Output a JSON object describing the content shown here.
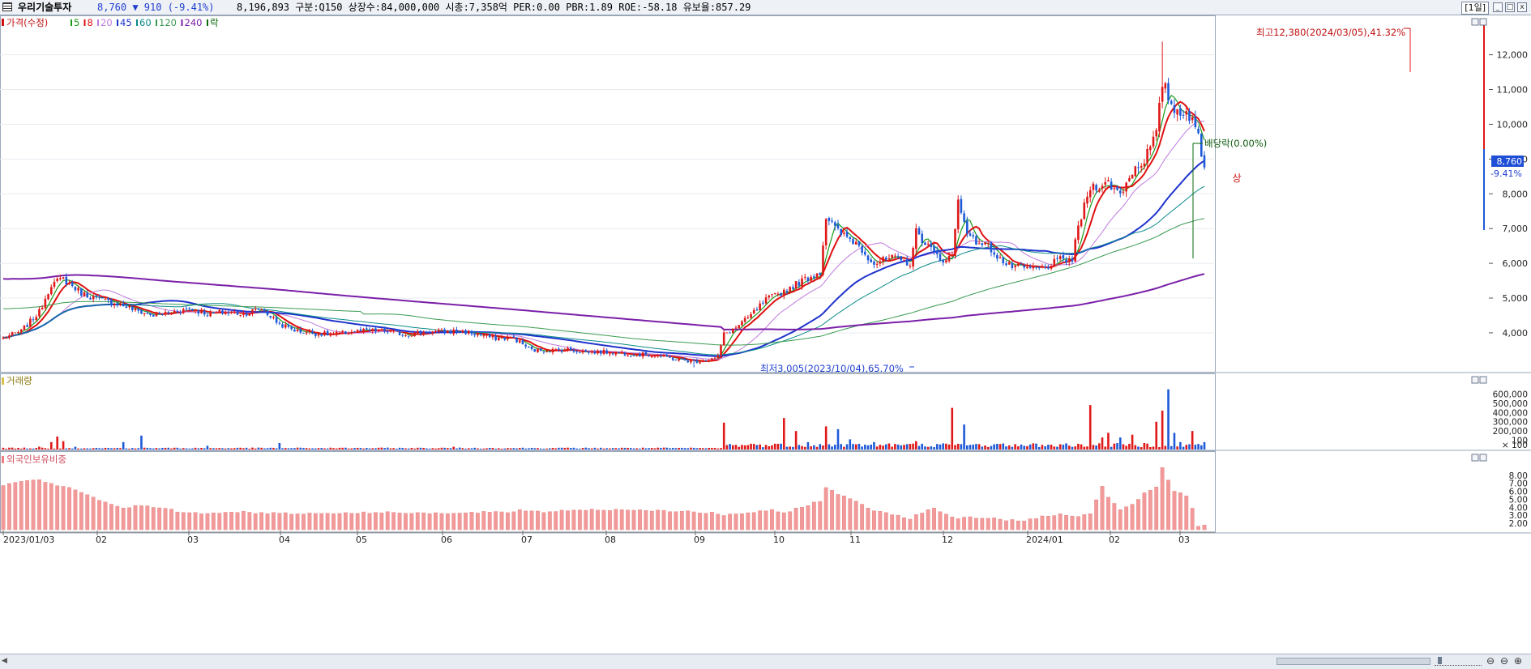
{
  "header": {
    "stock_name": "우리기술투자",
    "price_text": "8,760 ▼ 910 (-9.41%)",
    "info_text": "8,196,893 구분:Q150 상장수:84,000,000 시총:7,358억 PER:0.00 PBR:1.89 ROE:-58.18 유보율:857.29",
    "period_label": "[1일]",
    "win_minimize": "_",
    "win_restore": "□",
    "win_close": "x"
  },
  "legend_price": {
    "title": "가격(수정)",
    "items": [
      {
        "label": "5",
        "color": "#1a9a1a"
      },
      {
        "label": "8",
        "color": "#e01010"
      },
      {
        "label": "20",
        "color": "#c07adc"
      },
      {
        "label": "45",
        "color": "#1f33cc"
      },
      {
        "label": "60",
        "color": "#0a8a8a"
      },
      {
        "label": "120",
        "color": "#3a9a50"
      },
      {
        "label": "240",
        "color": "#7a1fa8"
      },
      {
        "label": "락",
        "color": "#0a6a0a"
      }
    ]
  },
  "annotations": {
    "high": "최고12,380(2024/03/05),41.32%",
    "low": "최저3,005(2023/10/04),65.70%",
    "dividend": "배당락(0.00%)",
    "limit_up": "상"
  },
  "current_price_label": "8,760",
  "current_change_label": "-9.41%",
  "chart_data": [
    {
      "type": "candlestick",
      "title": "가격(수정)",
      "y_ticks": [
        4000,
        5000,
        6000,
        7000,
        8000,
        9000,
        10000,
        11000,
        12000
      ],
      "y_tick_labels": [
        "4,000",
        "5,000",
        "6,000",
        "7,000",
        "8,000",
        "9,000",
        "10,000",
        "11,000",
        "12,000"
      ],
      "ylim": [
        2950,
        12900
      ],
      "x_labels": [
        "2023/01/03",
        "02",
        "03",
        "04",
        "05",
        "06",
        "07",
        "08",
        "09",
        "10",
        "11",
        "12",
        "2024/01",
        "02",
        "03"
      ],
      "anchor_closes": [
        [
          0,
          3850
        ],
        [
          6,
          4050
        ],
        [
          12,
          4600
        ],
        [
          16,
          5400
        ],
        [
          20,
          5550
        ],
        [
          26,
          5150
        ],
        [
          32,
          4950
        ],
        [
          38,
          4850
        ],
        [
          44,
          4650
        ],
        [
          50,
          4500
        ],
        [
          56,
          4600
        ],
        [
          62,
          4700
        ],
        [
          68,
          4550
        ],
        [
          74,
          4600
        ],
        [
          80,
          4550
        ],
        [
          86,
          4700
        ],
        [
          92,
          4250
        ],
        [
          98,
          4050
        ],
        [
          104,
          3980
        ],
        [
          110,
          3950
        ],
        [
          116,
          4030
        ],
        [
          122,
          4060
        ],
        [
          128,
          4040
        ],
        [
          134,
          3950
        ],
        [
          140,
          4020
        ],
        [
          146,
          4030
        ],
        [
          152,
          4050
        ],
        [
          158,
          3950
        ],
        [
          164,
          3850
        ],
        [
          170,
          3850
        ],
        [
          176,
          3500
        ],
        [
          182,
          3500
        ],
        [
          188,
          3520
        ],
        [
          194,
          3450
        ],
        [
          200,
          3450
        ],
        [
          206,
          3420
        ],
        [
          212,
          3380
        ],
        [
          218,
          3350
        ],
        [
          224,
          3240
        ],
        [
          230,
          3180
        ],
        [
          236,
          3250
        ],
        [
          238,
          3300
        ],
        [
          240,
          3960
        ],
        [
          244,
          4150
        ],
        [
          248,
          4420
        ],
        [
          254,
          4950
        ],
        [
          260,
          5200
        ],
        [
          266,
          5500
        ],
        [
          272,
          5750
        ],
        [
          274,
          7350
        ],
        [
          278,
          6900
        ],
        [
          284,
          6600
        ],
        [
          290,
          6000
        ],
        [
          296,
          6150
        ],
        [
          302,
          6000
        ],
        [
          304,
          6900
        ],
        [
          308,
          6500
        ],
        [
          312,
          6100
        ],
        [
          316,
          6200
        ],
        [
          318,
          7800
        ],
        [
          322,
          6700
        ],
        [
          328,
          6500
        ],
        [
          334,
          5950
        ],
        [
          340,
          5850
        ],
        [
          346,
          5850
        ],
        [
          352,
          6100
        ],
        [
          356,
          6100
        ],
        [
          358,
          7050
        ],
        [
          362,
          8200
        ],
        [
          368,
          8300
        ],
        [
          372,
          8000
        ],
        [
          376,
          8650
        ],
        [
          380,
          9000
        ],
        [
          384,
          9700
        ],
        [
          386,
          11200
        ],
        [
          390,
          10400
        ],
        [
          394,
          10400
        ],
        [
          398,
          9680
        ],
        [
          400,
          8760
        ]
      ],
      "moving_averages": [
        {
          "name": "5",
          "color": "#1a9a1a"
        },
        {
          "name": "8",
          "color": "#e01010"
        },
        {
          "name": "20",
          "color": "#c07adc"
        },
        {
          "name": "45",
          "color": "#1f33cc"
        },
        {
          "name": "60",
          "color": "#0a8a8a"
        },
        {
          "name": "120",
          "color": "#3a9a50"
        },
        {
          "name": "240",
          "color": "#7a1fa8"
        }
      ],
      "high": 12380,
      "low": 3005,
      "last_close": 8760
    },
    {
      "type": "bar",
      "title": "거래량",
      "y_ticks": [
        100000,
        200000,
        300000,
        400000,
        500000,
        600000
      ],
      "y_tick_labels": [
        "100",
        "200,000",
        "300,000",
        "400,000",
        "500,000",
        "600,000"
      ],
      "unit_label": "× 100",
      "ylim": [
        0,
        700000
      ],
      "spikes": [
        [
          12,
          30000
        ],
        [
          16,
          80000
        ],
        [
          18,
          140000
        ],
        [
          20,
          90000
        ],
        [
          24,
          30000
        ],
        [
          40,
          80000
        ],
        [
          46,
          150000
        ],
        [
          68,
          40000
        ],
        [
          92,
          70000
        ],
        [
          150,
          30000
        ],
        [
          240,
          290000
        ],
        [
          244,
          50000
        ],
        [
          250,
          60000
        ],
        [
          254,
          50000
        ],
        [
          260,
          340000
        ],
        [
          264,
          200000
        ],
        [
          268,
          80000
        ],
        [
          274,
          250000
        ],
        [
          278,
          220000
        ],
        [
          282,
          110000
        ],
        [
          290,
          80000
        ],
        [
          300,
          50000
        ],
        [
          304,
          90000
        ],
        [
          316,
          450000
        ],
        [
          320,
          270000
        ],
        [
          324,
          60000
        ],
        [
          340,
          40000
        ],
        [
          362,
          480000
        ],
        [
          366,
          130000
        ],
        [
          368,
          180000
        ],
        [
          372,
          130000
        ],
        [
          376,
          160000
        ],
        [
          380,
          70000
        ],
        [
          384,
          300000
        ],
        [
          386,
          420000
        ],
        [
          388,
          650000
        ],
        [
          390,
          180000
        ],
        [
          392,
          80000
        ],
        [
          396,
          200000
        ],
        [
          400,
          80000
        ]
      ]
    },
    {
      "type": "bar",
      "title": "외국인보유비중",
      "y_ticks": [
        2,
        3,
        4,
        5,
        6,
        7,
        8
      ],
      "y_tick_labels": [
        "2.00",
        "3.00",
        "4.00",
        "5.00",
        "6.00",
        "7.00",
        "8.00"
      ],
      "ylim": [
        1.2,
        9.5
      ],
      "anchors": [
        [
          0,
          6.8
        ],
        [
          6,
          7.2
        ],
        [
          12,
          7.5
        ],
        [
          16,
          6.9
        ],
        [
          22,
          6.4
        ],
        [
          28,
          5.6
        ],
        [
          34,
          4.6
        ],
        [
          40,
          4.0
        ],
        [
          46,
          4.2
        ],
        [
          52,
          3.9
        ],
        [
          60,
          3.4
        ],
        [
          68,
          3.2
        ],
        [
          76,
          3.5
        ],
        [
          84,
          3.3
        ],
        [
          92,
          3.3
        ],
        [
          100,
          3.2
        ],
        [
          110,
          3.3
        ],
        [
          120,
          3.3
        ],
        [
          130,
          3.4
        ],
        [
          140,
          3.3
        ],
        [
          150,
          3.2
        ],
        [
          160,
          3.4
        ],
        [
          168,
          3.3
        ],
        [
          172,
          3.7
        ],
        [
          180,
          3.4
        ],
        [
          190,
          3.7
        ],
        [
          200,
          3.7
        ],
        [
          210,
          3.7
        ],
        [
          220,
          3.6
        ],
        [
          230,
          3.4
        ],
        [
          236,
          3.3
        ],
        [
          240,
          2.9
        ],
        [
          244,
          3.2
        ],
        [
          250,
          3.4
        ],
        [
          256,
          3.6
        ],
        [
          260,
          3.3
        ],
        [
          266,
          4.1
        ],
        [
          272,
          4.8
        ],
        [
          274,
          6.5
        ],
        [
          278,
          5.6
        ],
        [
          284,
          4.8
        ],
        [
          290,
          3.6
        ],
        [
          296,
          3.2
        ],
        [
          302,
          2.6
        ],
        [
          306,
          3.4
        ],
        [
          310,
          3.8
        ],
        [
          314,
          3.2
        ],
        [
          318,
          2.6
        ],
        [
          322,
          2.7
        ],
        [
          328,
          2.7
        ],
        [
          334,
          2.4
        ],
        [
          340,
          2.4
        ],
        [
          346,
          2.8
        ],
        [
          352,
          3.1
        ],
        [
          356,
          2.9
        ],
        [
          362,
          3.1
        ],
        [
          366,
          6.7
        ],
        [
          368,
          5.3
        ],
        [
          372,
          3.6
        ],
        [
          376,
          4.3
        ],
        [
          380,
          5.7
        ],
        [
          384,
          6.6
        ],
        [
          386,
          9.0
        ],
        [
          390,
          6.0
        ],
        [
          394,
          5.4
        ],
        [
          396,
          3.9
        ],
        [
          398,
          1.6
        ],
        [
          400,
          1.8
        ]
      ]
    }
  ]
}
